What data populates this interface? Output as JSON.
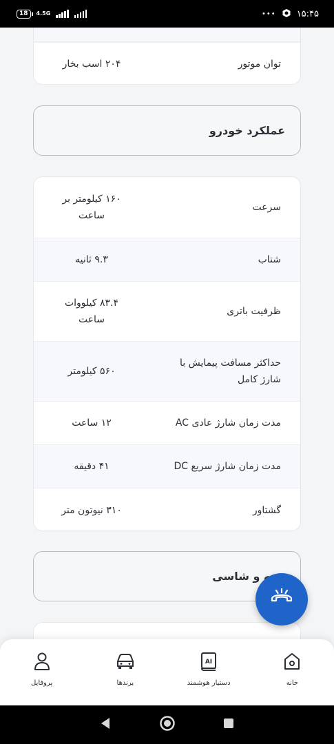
{
  "status_bar": {
    "battery": "18",
    "network": "4.5G",
    "dots": "•••",
    "time": "۱۵:۴۵"
  },
  "engine_power": {
    "label": "توان موتور",
    "value": "۲۰۴ اسب بخار"
  },
  "performance": {
    "title": "عملکرد خودرو",
    "rows": [
      {
        "label": "سرعت",
        "value": "۱۶۰ کیلومتر بر ساعت"
      },
      {
        "label": "شتاب",
        "value": "۹.۳ ثانیه"
      },
      {
        "label": "ظرفیت باتری",
        "value": "۸۳.۴ کیلووات ساعت"
      },
      {
        "label": "حداکثر مسافت پیمایش با شارژ کامل",
        "value": "۵۶۰ کیلومتر"
      },
      {
        "label": "مدت زمان شارژ عادی AC",
        "value": "۱۲ ساعت"
      },
      {
        "label": "مدت زمان شارژ سریع DC",
        "value": "۴۱ دقیقه"
      },
      {
        "label": "گشتاور",
        "value": "۳۱۰ نیوتون متر"
      }
    ]
  },
  "next_section": {
    "title": "بدنه و شاسی"
  },
  "bottom_nav": {
    "home": "خانه",
    "assistant": "دستیار هوشمند",
    "brands": "برندها",
    "profile": "پروفایل"
  },
  "icons": {
    "fab": "phone-icon",
    "home": "home-icon",
    "assistant": "ai-book-icon",
    "brands": "car-icon",
    "profile": "user-icon"
  },
  "colors": {
    "accent": "#1f64c8",
    "background": "#f4f5f7"
  }
}
